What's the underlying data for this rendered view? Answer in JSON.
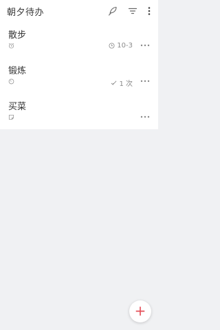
{
  "header": {
    "title": "朝夕待办",
    "icons": [
      "feather-icon",
      "filter-icon",
      "more-vertical-icon"
    ]
  },
  "tasks": [
    {
      "title": "散步",
      "type_icon": "alarm-clock-icon",
      "meta_icon": "clock-icon",
      "meta_text": "10-3"
    },
    {
      "title": "锻炼",
      "type_icon": "timer-icon",
      "meta_icon": "check-icon",
      "meta_text": "1 次"
    },
    {
      "title": "买菜",
      "type_icon": "note-icon",
      "meta_icon": "",
      "meta_text": ""
    }
  ],
  "fab": {
    "label": "+"
  },
  "colors": {
    "accent": "#e4505a",
    "background": "#f0f1f3"
  }
}
